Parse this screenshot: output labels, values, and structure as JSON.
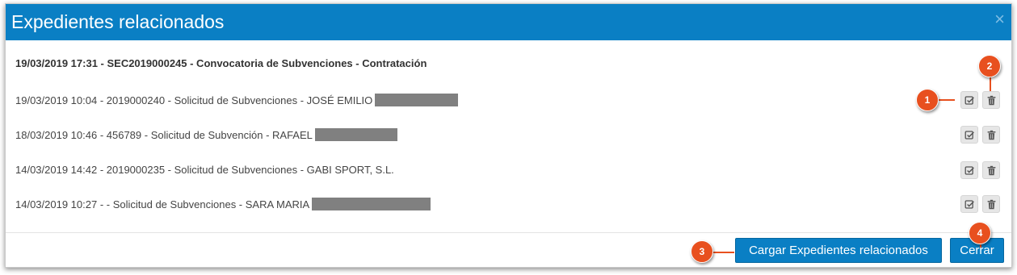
{
  "dialog": {
    "title": "Expedientes relacionados",
    "close_glyph": "×"
  },
  "main_record": "19/03/2019 17:31 - SEC2019000245 - Convocatoria de Subvenciones - Contratación",
  "related": [
    {
      "text": "19/03/2019 10:04 - 2019000240 - Solicitud de Subvenciones - JOSÉ EMILIO",
      "redacted": true
    },
    {
      "text": "18/03/2019 10:46 - 456789 - Solicitud de Subvención - RAFAEL",
      "redacted": true
    },
    {
      "text": "14/03/2019 14:42 - 2019000235 - Solicitud de Subvenciones - GABI SPORT, S.L.",
      "redacted": false
    },
    {
      "text": "14/03/2019 10:27 - - Solicitud de Subvenciones - SARA MARIA",
      "redacted": true
    }
  ],
  "row_actions": {
    "select_icon": "check-square-icon",
    "delete_icon": "trash-icon"
  },
  "footer": {
    "load_button": "Cargar Expedientes relacionados",
    "close_button": "Cerrar"
  },
  "callouts": [
    "1",
    "2",
    "3",
    "4"
  ],
  "colors": {
    "header": "#0a7fc4",
    "button": "#0a7fc4",
    "callout": "#e8501f",
    "redaction": "#808080"
  }
}
